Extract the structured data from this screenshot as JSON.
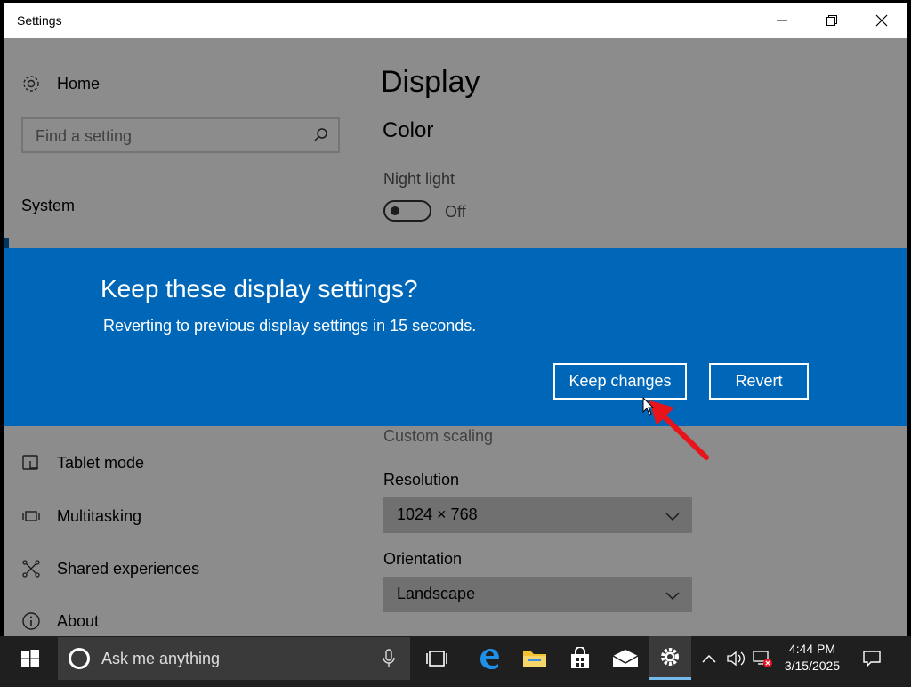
{
  "window": {
    "title": "Settings"
  },
  "sidebar": {
    "home_label": "Home",
    "search_placeholder": "Find a setting",
    "section_label": "System",
    "items": [
      {
        "label": "Tablet mode",
        "icon": "tablet-mode-icon"
      },
      {
        "label": "Multitasking",
        "icon": "multitasking-icon"
      },
      {
        "label": "Shared experiences",
        "icon": "shared-experiences-icon"
      },
      {
        "label": "About",
        "icon": "info-icon"
      }
    ]
  },
  "main": {
    "page_title": "Display",
    "color_heading": "Color",
    "night_light_label": "Night light",
    "night_light_state": "Off",
    "custom_scaling_link": "Custom scaling",
    "resolution_label": "Resolution",
    "resolution_value": "1024 × 768",
    "orientation_label": "Orientation",
    "orientation_value": "Landscape"
  },
  "dialog": {
    "title": "Keep these display settings?",
    "message": "Reverting to previous display settings in 15 seconds.",
    "keep_label": "Keep changes",
    "revert_label": "Revert"
  },
  "taskbar": {
    "search_placeholder": "Ask me anything",
    "time": "4:44 PM",
    "date": "3/15/2025"
  },
  "colors": {
    "dialog_bg": "#0067b8",
    "accent": "#0063b1",
    "taskbar_bg": "#1f1f1f"
  }
}
